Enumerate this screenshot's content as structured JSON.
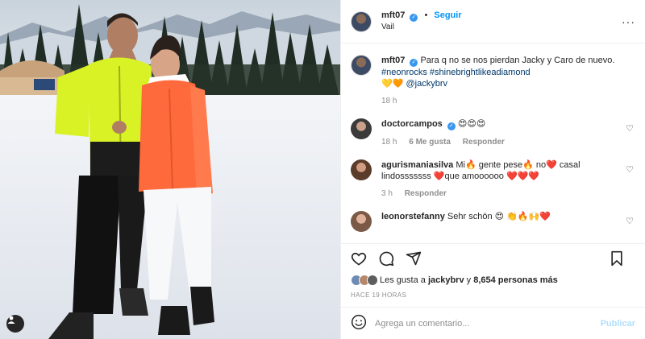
{
  "post": {
    "author": "mft07",
    "follow_label": "Seguir",
    "dot": "•",
    "location": "Vail",
    "more_label": "···"
  },
  "caption": {
    "author": "mft07",
    "text": "Para q no se nos pierdan Jacky y Caro de nuevo.",
    "hashtags": "#neonrocks #shinebrightlikeadiamond",
    "hearts": "💛🧡",
    "mention": "@jackybrv",
    "time": "18 h"
  },
  "comments": [
    {
      "user": "doctorcampos",
      "verified": true,
      "text": "😍😍😍",
      "time": "18 h",
      "likes": "6 Me gusta",
      "reply": "Responder"
    },
    {
      "user": "agurismaniasilva",
      "verified": false,
      "text": "Mi🔥 gente pese🔥 no❤️ casal lindosssssss ❤️que amoooooo ❤️❤️❤️",
      "time": "3 h",
      "likes": "",
      "reply": "Responder"
    },
    {
      "user": "leonorstefanny",
      "verified": false,
      "text": "Sehr schön 😍 👏🔥🙌❤️",
      "time": "",
      "likes": "",
      "reply": ""
    }
  ],
  "likes": {
    "prefix": "Les gusta a",
    "user": "jackybrv",
    "joiner": "y",
    "count": "8,654 personas más"
  },
  "timestamp": "Hace 19 horas",
  "composer": {
    "placeholder": "Agrega un comentario...",
    "post_label": "Publicar"
  },
  "colors": {
    "accent": "#0095f6",
    "verified": "#3897f0",
    "post_disabled": "#b2dffc",
    "jacket_yellow": "#d9f225",
    "jacket_orange": "#ff6a3d"
  },
  "icons": {
    "like": "heart-icon",
    "comment": "comment-icon",
    "share": "send-icon",
    "save": "bookmark-icon",
    "emoji": "smiley-icon",
    "user_tag": "person-icon"
  }
}
